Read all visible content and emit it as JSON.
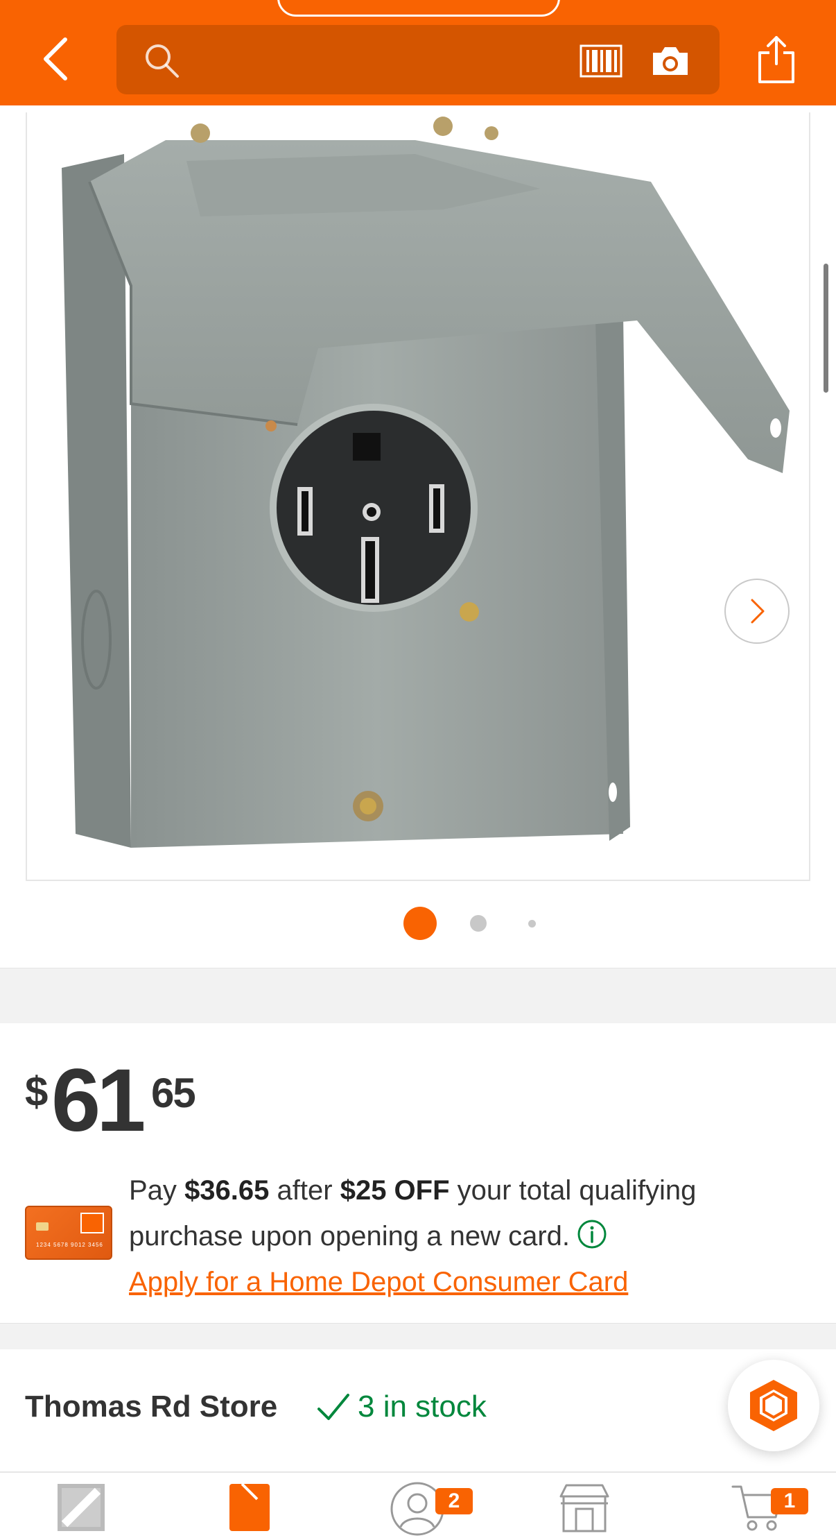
{
  "header": {
    "search_placeholder": "",
    "back_label": "back",
    "share_label": "share"
  },
  "gallery": {
    "image_count": 3,
    "active_index": 1
  },
  "price": {
    "currency": "$",
    "dollars": "61",
    "cents": "65"
  },
  "promo": {
    "pay_prefix": "Pay",
    "pay_amount": "$36.65",
    "after": "after",
    "discount": "$25 OFF",
    "rest_line1": "your total qualifying",
    "rest_line2": "purchase upon opening a new card.",
    "link": "Apply for a Home Depot Consumer Card",
    "card_number": "1234 5678 9012 3456"
  },
  "store": {
    "name": "Thomas Rd Store",
    "stock": "3 in stock"
  },
  "bottom_nav": {
    "account_badge": "2",
    "cart_badge": "1"
  },
  "colors": {
    "brand_orange": "#f96302",
    "search_bg": "#d45500",
    "stock_green": "#00873c",
    "text": "#333333"
  }
}
